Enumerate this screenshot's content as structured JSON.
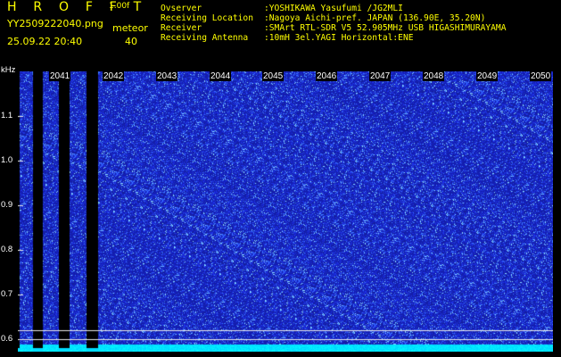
{
  "header": {
    "logo": "H R O F F T",
    "version": "1.00f",
    "filename": "YY2509222040.png",
    "meteor_label": "meteor",
    "datetime": "25.09.22 20:40",
    "meteor_count": "40"
  },
  "info": [
    {
      "key": "Ovserver",
      "value": ":YOSHIKAWA Yasufumi /JG2MLI"
    },
    {
      "key": "Receiving Location",
      "value": ":Nagoya Aichi-pref. JAPAN (136.90E, 35.20N)"
    },
    {
      "key": "Receiver",
      "value": ":SMArt RTL-SDR V5 52.905MHz USB HIGASHIMURAYAMA"
    },
    {
      "key": "Receiving Antenna",
      "value": ":10mH 3el.YAGI Horizontal:ENE"
    }
  ],
  "y_axis": {
    "unit": "kHz",
    "ticks": [
      "1.1",
      "1.0",
      "0.9",
      "0.8",
      "0.7",
      "0.6"
    ]
  },
  "time_ticks": [
    "2041",
    "2042",
    "2043",
    "2044",
    "2045",
    "2046",
    "2047",
    "2048",
    "2049",
    "2050"
  ],
  "colors": {
    "text_header": "#ffff00",
    "background": "#000000",
    "noise_base": "#1a2cc8",
    "noise_bright": "#3fa8ff",
    "bottom_band": "#00e5ff"
  }
}
